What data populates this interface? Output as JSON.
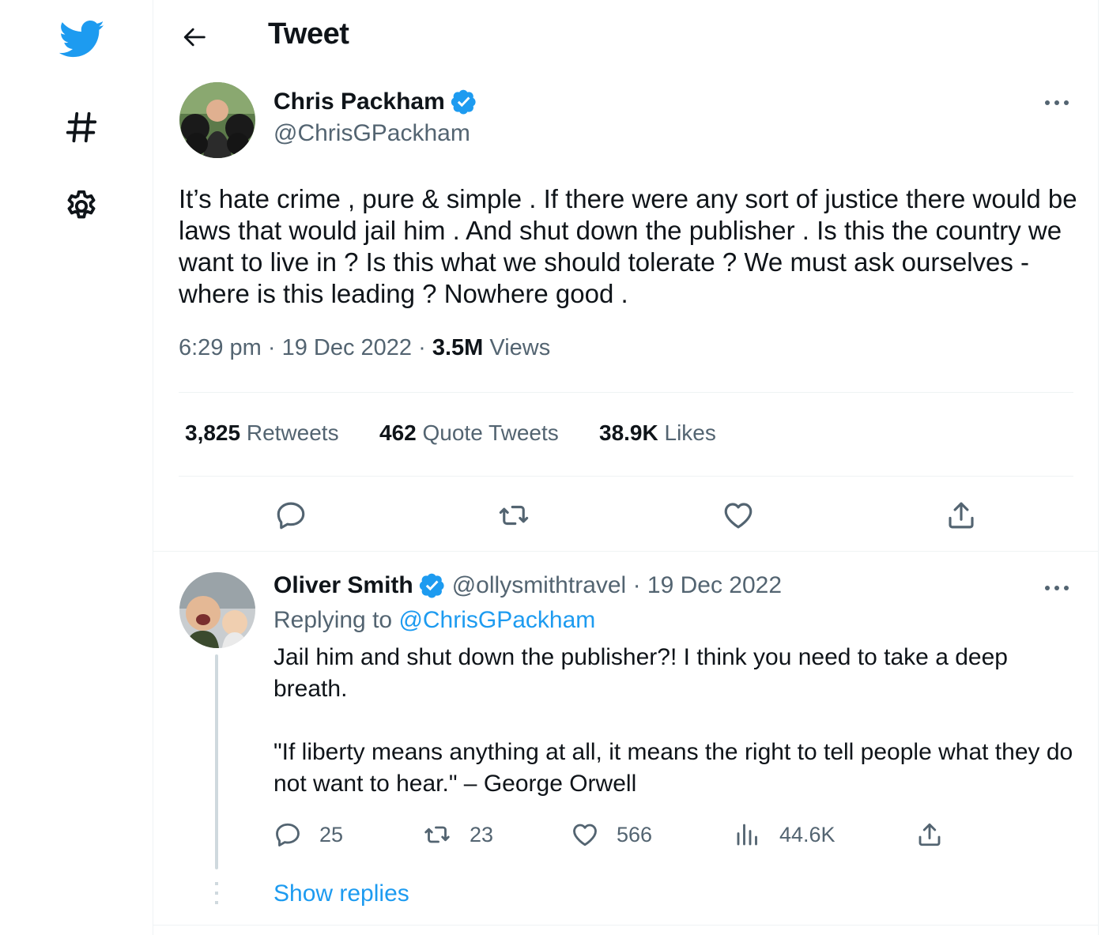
{
  "sidebar": {
    "logo_icon": "twitter-bird-icon",
    "explore_icon": "hashtag-icon",
    "settings_icon": "gear-icon"
  },
  "header": {
    "title": "Tweet",
    "back_icon": "back-arrow-icon"
  },
  "tweet": {
    "author_name": "Chris Packham",
    "author_handle": "@ChrisGPackham",
    "text": "It’s hate crime , pure & simple . If there were any sort of justice there would be laws that would jail him . And shut down the publisher . Is this the country we want to live in ? Is this what we should tolerate ? We must ask ourselves - where is this leading ? Nowhere good .",
    "time": "6:29 pm",
    "date": "19 Dec 2022",
    "views_count": "3.5M",
    "views_label": "Views",
    "retweets_count": "3,825",
    "retweets_label": "Retweets",
    "quotes_count": "462",
    "quotes_label": "Quote Tweets",
    "likes_count": "38.9K",
    "likes_label": "Likes"
  },
  "reply": {
    "author_name": "Oliver Smith",
    "author_handle": "@ollysmithtravel",
    "date": "19 Dec 2022",
    "replying_prefix": "Replying to",
    "replying_to": "@ChrisGPackham",
    "paragraph1": "Jail him and shut down the publisher?! I think you need to take a deep breath.",
    "paragraph2": "\"If liberty means anything at all, it means the right to tell people what they do not want to hear.\" – George Orwell",
    "reply_count": "25",
    "retweet_count": "23",
    "like_count": "566",
    "view_count": "44.6K",
    "show_replies": "Show replies"
  },
  "colors": {
    "accent": "#1d9bf0",
    "muted": "#536471",
    "text": "#0f1419",
    "border": "#eff3f4"
  }
}
